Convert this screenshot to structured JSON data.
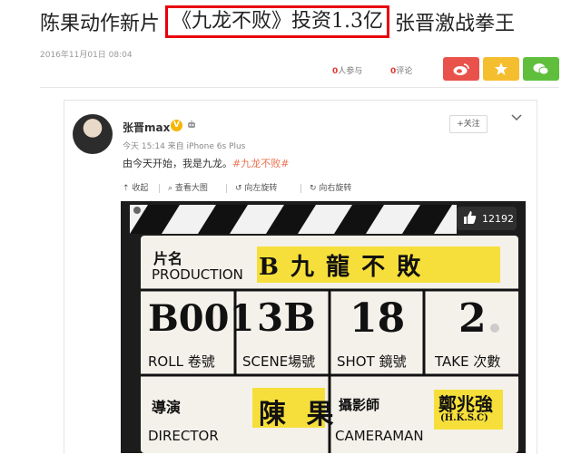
{
  "article": {
    "title_part1": "陈果动作新片",
    "title_highlight": "《九龙不败》投资1.3亿",
    "title_part2": "张晋激战拳王",
    "date": "2016年11月01日  08:04",
    "participants_count": "0",
    "participants_label": "人参与",
    "comments_count": "0",
    "comments_label": "评论"
  },
  "share": {
    "weibo_color": "#e8524a",
    "qzone_color": "#f5be2e",
    "wechat_color": "#5fbf3d"
  },
  "post": {
    "username": "张晋max",
    "verified_badge": "V",
    "follow_label": "+关注",
    "time_source": "今天 15:14 来自 iPhone 6s Plus",
    "text": "由今天开始，我是九龙。",
    "hashtag": "#九龙不败#",
    "toolbar": {
      "collapse": "收起",
      "view_large": "查看大图",
      "rotate_left": "向左旋转",
      "rotate_right": "向右旋转"
    },
    "likes_count": "12192"
  },
  "slate": {
    "title_cn": "片名",
    "production_label": "PRODUCTION",
    "production_value": "B 九 龍 不 敗",
    "roll_label": "ROLL",
    "roll_cn": "卷號",
    "roll_value": "B001",
    "scene_label": "SCENE",
    "scene_cn": "場號",
    "scene_value": "3B",
    "shot_label": "SHOT",
    "shot_cn": "鏡號",
    "shot_value": "18",
    "take_label": "TAKE",
    "take_cn": "次數",
    "take_value": "2",
    "director_cn": "導演",
    "director_label": "DIRECTOR",
    "director_value": "陳 果",
    "cameraman_cn": "攝影師",
    "cameraman_label": "CAMERAMAN",
    "cameraman_value": "鄭兆強",
    "cameraman_sub": "(H.K.S.C)"
  }
}
